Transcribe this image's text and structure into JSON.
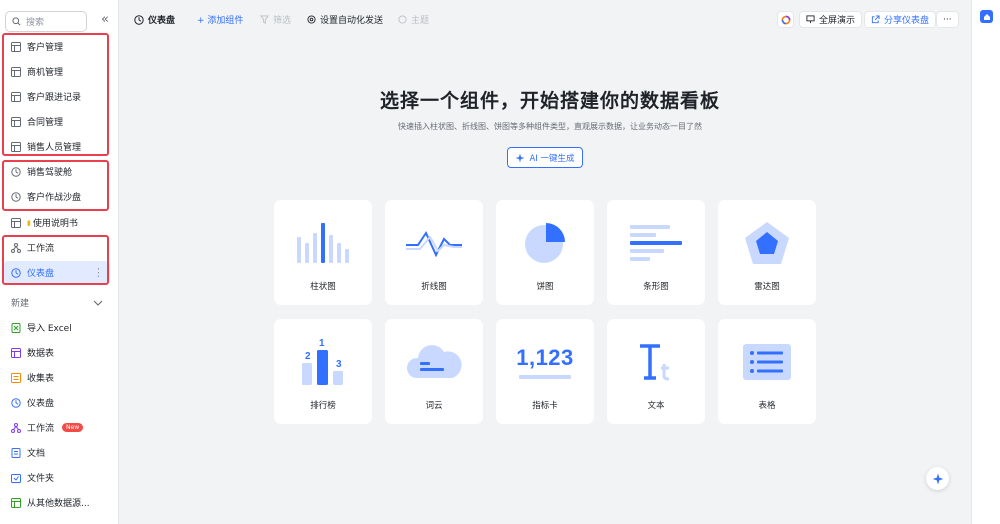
{
  "sidebar": {
    "search_placeholder": "搜索",
    "collapse_icon": "«",
    "items": [
      {
        "label": "客户管理",
        "icon": "table-icon"
      },
      {
        "label": "商机管理",
        "icon": "table-icon"
      },
      {
        "label": "客户跟进记录",
        "icon": "table-icon"
      },
      {
        "label": "合同管理",
        "icon": "table-icon"
      },
      {
        "label": "销售人员管理",
        "icon": "table-icon"
      },
      {
        "label": "销售驾驶舱",
        "icon": "dashboard-icon"
      },
      {
        "label": "客户作战沙盘",
        "icon": "dashboard-icon"
      },
      {
        "label": "使用说明书",
        "icon": "doc-icon"
      },
      {
        "label": "工作流",
        "icon": "workflow-icon"
      },
      {
        "label": "仪表盘",
        "icon": "dashboard-icon",
        "active": true
      }
    ],
    "new_section_label": "新建",
    "new_items": [
      {
        "label": "导入 Excel",
        "icon": "excel-icon"
      },
      {
        "label": "数据表",
        "icon": "table-icon"
      },
      {
        "label": "收集表",
        "icon": "form-icon"
      },
      {
        "label": "仪表盘",
        "icon": "dashboard-icon"
      },
      {
        "label": "工作流",
        "icon": "workflow-icon",
        "badge": "New"
      },
      {
        "label": "文档",
        "icon": "doc-icon"
      },
      {
        "label": "文件夹",
        "icon": "folder-icon"
      },
      {
        "label": "从其他数据源...",
        "icon": "datasource-icon"
      }
    ]
  },
  "toolbar": {
    "title": "仪表盘",
    "add_component": "+ 添加组件",
    "filter": "筛选",
    "auto_send": "设置自动化发送",
    "theme": "主题",
    "fullscreen": "全屏演示",
    "share": "分享仪表盘",
    "more": "···"
  },
  "main": {
    "headline": "选择一个组件，开始搭建你的数据看板",
    "subline": "快速插入柱状图、折线图、饼图等多种组件类型，直观展示数据，让业务动态一目了然",
    "ai_button": "AI 一键生成",
    "components": [
      {
        "label": "柱状图",
        "icon": "bar-chart-icon"
      },
      {
        "label": "折线图",
        "icon": "line-chart-icon"
      },
      {
        "label": "饼图",
        "icon": "pie-chart-icon"
      },
      {
        "label": "条形图",
        "icon": "horizontal-bar-icon"
      },
      {
        "label": "雷达图",
        "icon": "radar-chart-icon"
      },
      {
        "label": "排行榜",
        "icon": "ranking-icon",
        "ranks": [
          "2",
          "1",
          "3"
        ]
      },
      {
        "label": "词云",
        "icon": "word-cloud-icon"
      },
      {
        "label": "指标卡",
        "icon": "metric-card-icon",
        "metric": "1,123"
      },
      {
        "label": "文本",
        "icon": "text-icon"
      },
      {
        "label": "表格",
        "icon": "table-grid-icon"
      }
    ]
  },
  "colors": {
    "accent": "#3370ff",
    "accent_light": "#c9d8ff",
    "highlight_border": "#e8404e",
    "active_bg": "#e1eaff"
  }
}
